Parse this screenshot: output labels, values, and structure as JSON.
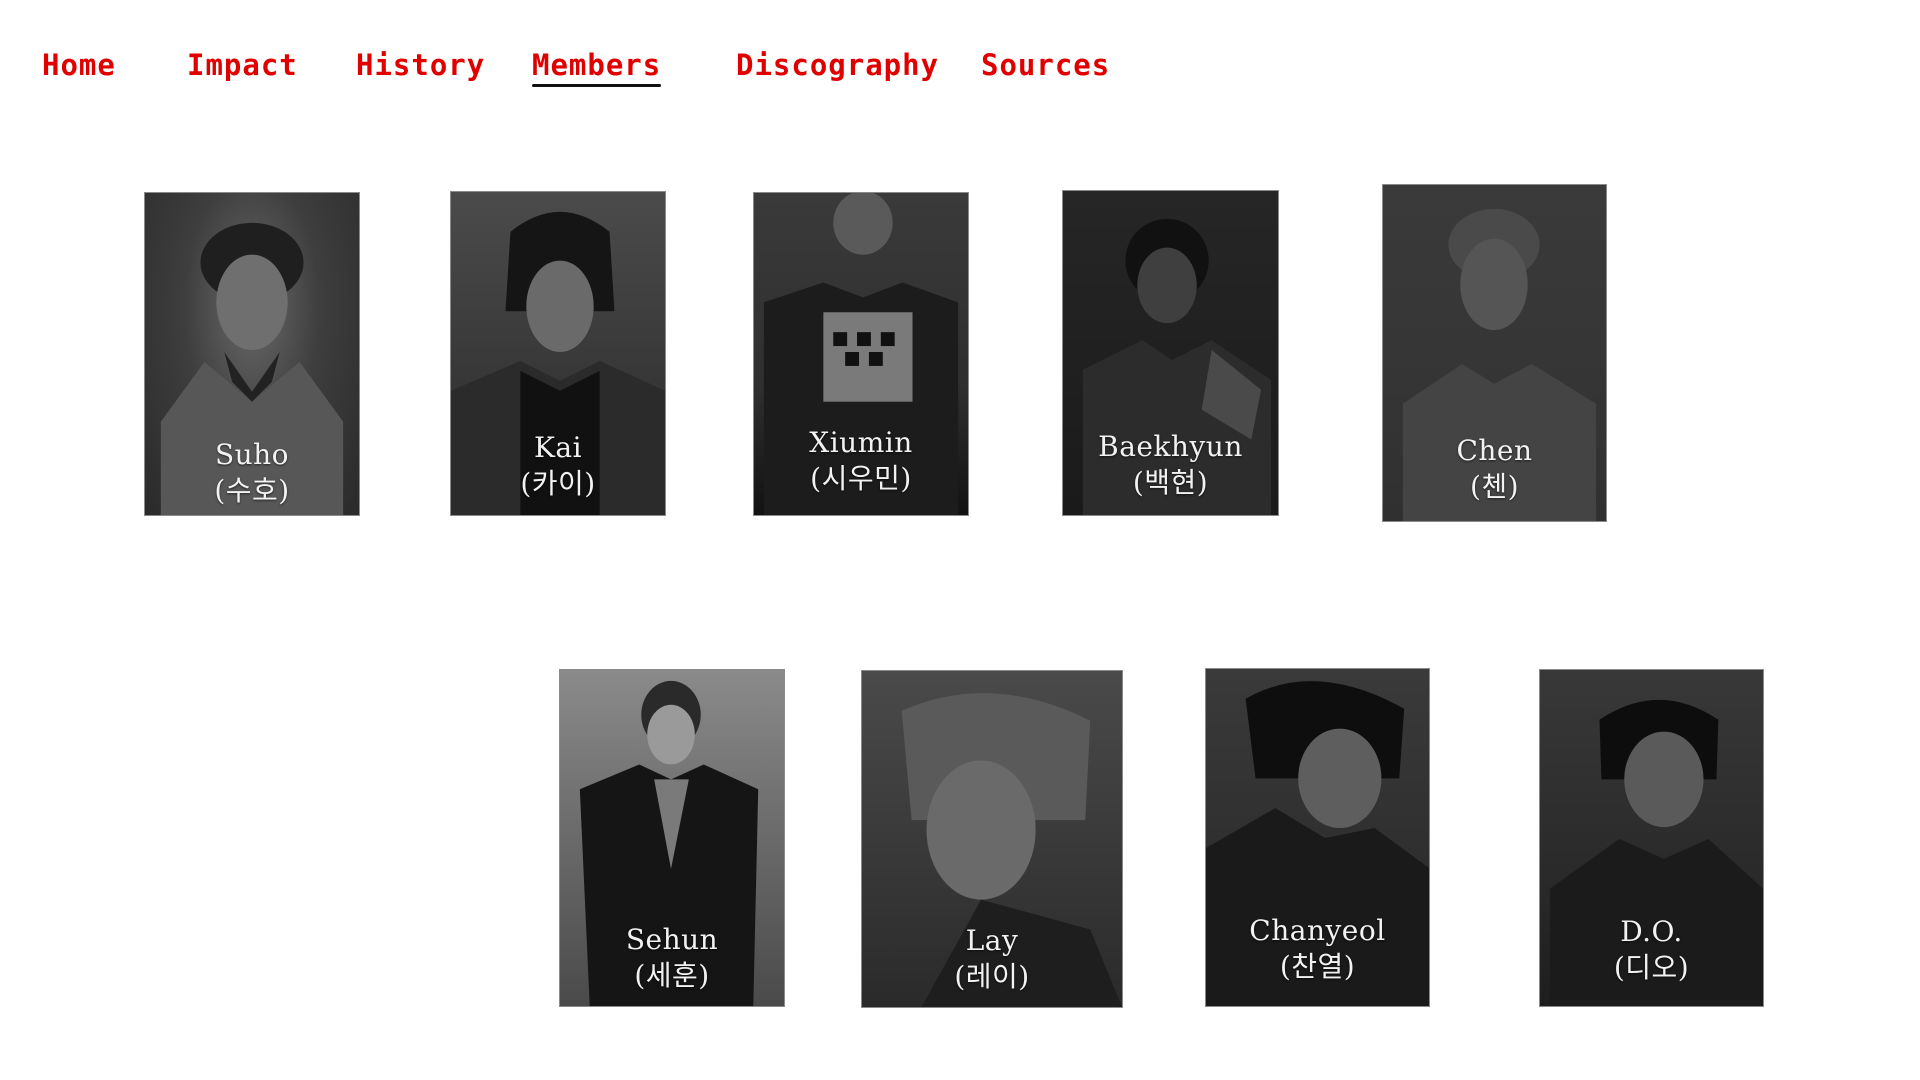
{
  "nav": {
    "items": [
      {
        "label": "Home"
      },
      {
        "label": "Impact"
      },
      {
        "label": "History"
      },
      {
        "label": "Members"
      },
      {
        "label": "Discography"
      },
      {
        "label": "Sources"
      }
    ],
    "active": "Members",
    "link_color": "#e00000"
  },
  "members": [
    {
      "name": "Suho",
      "korean": "(수호)"
    },
    {
      "name": "Kai",
      "korean": "(카이)"
    },
    {
      "name": "Xiumin",
      "korean": "(시우민)"
    },
    {
      "name": "Baekhyun",
      "korean": "(백현)"
    },
    {
      "name": "Chen",
      "korean": "(첸)"
    },
    {
      "name": "Sehun",
      "korean": "(세훈)"
    },
    {
      "name": "Lay",
      "korean": "(레이)"
    },
    {
      "name": "Chanyeol",
      "korean": "(찬열)"
    },
    {
      "name": "D.O.",
      "korean": "(디오)"
    }
  ]
}
